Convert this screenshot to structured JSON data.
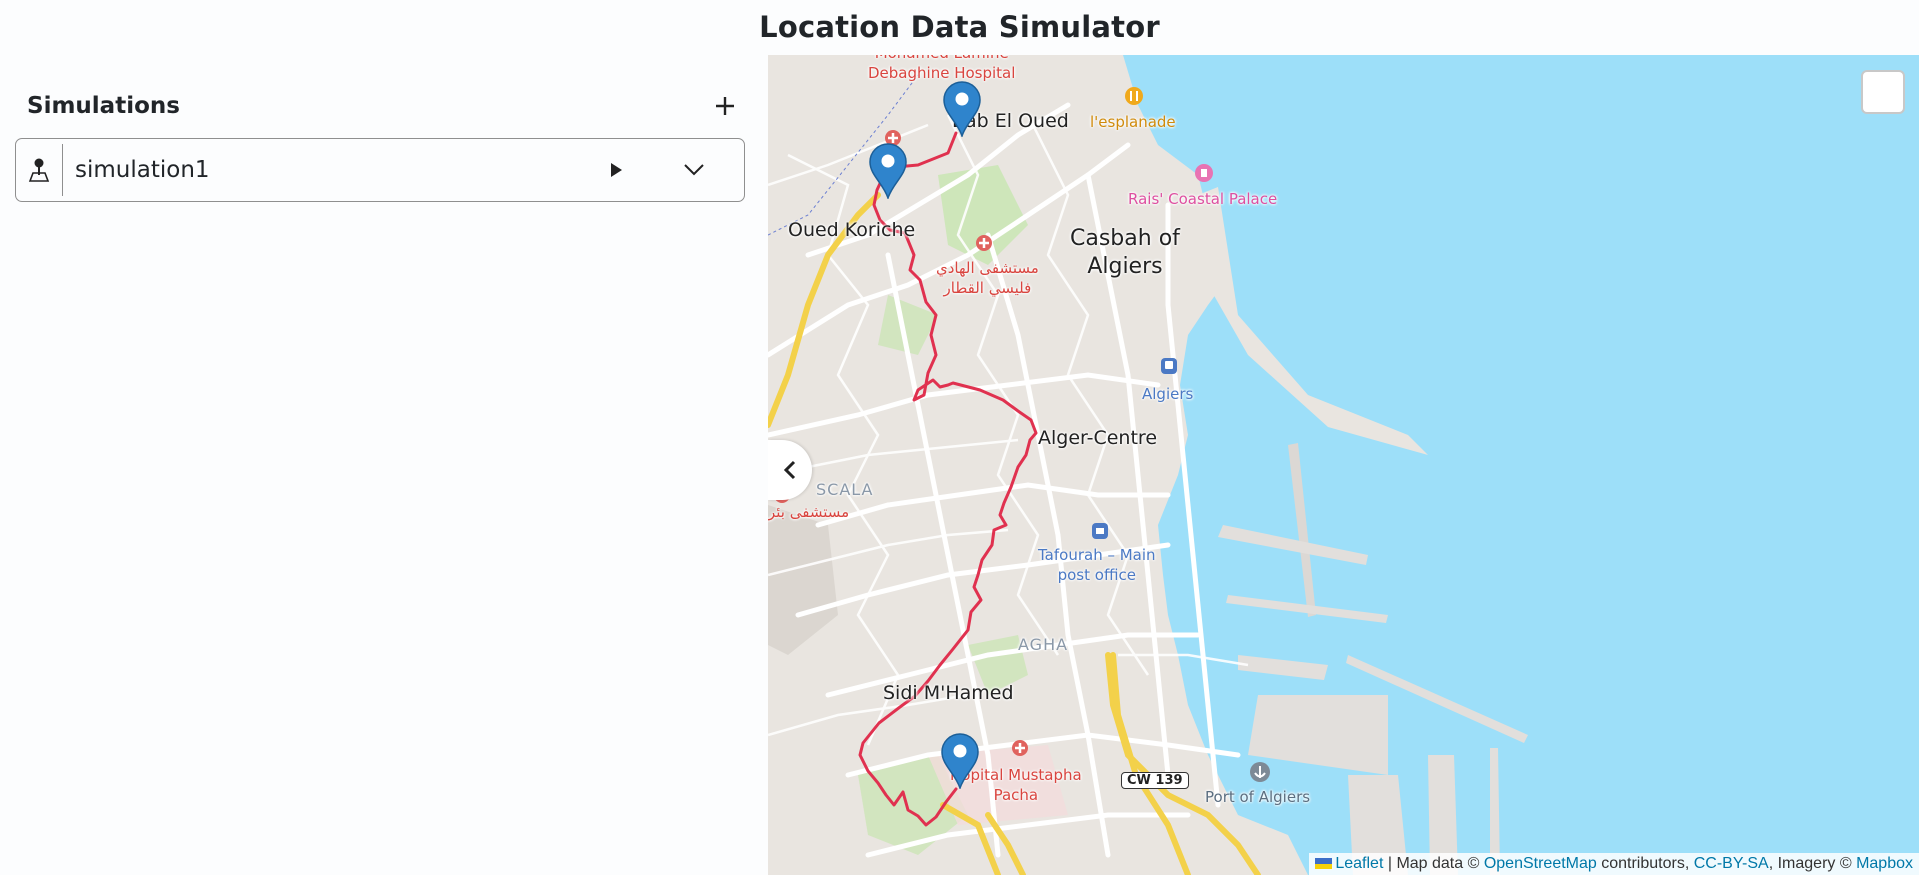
{
  "app": {
    "title": "Location Data Simulator"
  },
  "sidebar": {
    "title": "Simulations",
    "add_icon": "plus-icon",
    "simulations": [
      {
        "name": "simulation1",
        "icon": "person-pin-icon",
        "play_icon": "play-icon",
        "expand_icon": "chevron-down-icon"
      }
    ]
  },
  "map": {
    "labels": {
      "bab_el_oued": "Bab El Oued",
      "oued_koriche": "Oued Koriche",
      "casbah": "Casbah of\nAlgiers",
      "alger_centre": "Alger-Centre",
      "sidi_mhamed": "Sidi M'Hamed",
      "algiers_station": "Algiers",
      "debaghine": "Mohamed Lamine\nDebaghine Hospital",
      "esplanade": "l'esplanade",
      "rais_palace": "Rais' Coastal Palace",
      "hopital_arabic": "مستشفى الهادي\nفليسي القطار",
      "scala": "SCALA",
      "scala_hospital": "مستشفى بئر",
      "tafourah": "Tafourah – Main\npost office",
      "agha": "AGHA",
      "mustapha": "Hopital Mustapha\nPacha",
      "road_cw139": "CW 139",
      "port": "Port of Algiers"
    },
    "markers": [
      {
        "name": "start-marker",
        "label": "Bab El Oued"
      },
      {
        "name": "waypoint-marker",
        "label": "Oued Koriche"
      },
      {
        "name": "end-marker",
        "label": "Mustapha Pacha"
      }
    ],
    "route_color": "#e0314f",
    "water_color": "#9ddff9",
    "land_color": "#e9e5e0",
    "marker_color": "#2f84cc"
  },
  "attribution": {
    "leaflet": "Leaflet",
    "sep1": " | Map data © ",
    "osm": "OpenStreetMap",
    "sep2": " contributors, ",
    "ccbysa": "CC-BY-SA",
    "sep3": ", Imagery © ",
    "mapbox": "Mapbox"
  },
  "icons": {
    "layers": "layers-icon",
    "collapse": "chevron-left-icon"
  }
}
